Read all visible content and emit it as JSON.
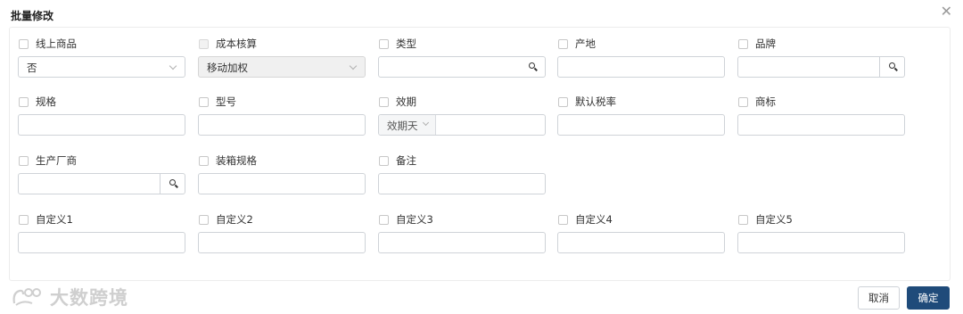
{
  "dialog": {
    "title": "批量修改",
    "close_label": "✕"
  },
  "rows": [
    [
      {
        "key": "online",
        "label": "线上商品",
        "control": "select",
        "value": "否"
      },
      {
        "key": "cost",
        "label": "成本核算",
        "control": "select",
        "value": "移动加权",
        "disabled": true
      },
      {
        "key": "category",
        "label": "类型",
        "control": "search",
        "value": ""
      },
      {
        "key": "origin",
        "label": "产地",
        "control": "input",
        "value": ""
      },
      {
        "key": "brand",
        "label": "品牌",
        "control": "search",
        "value": ""
      }
    ],
    [
      {
        "key": "spec",
        "label": "规格",
        "control": "input",
        "value": ""
      },
      {
        "key": "model",
        "label": "型号",
        "control": "input",
        "value": ""
      },
      {
        "key": "shelf_life",
        "label": "效期",
        "control": "unit-input",
        "unit": "效期天",
        "value": ""
      },
      {
        "key": "tax",
        "label": "默认税率",
        "control": "input",
        "value": ""
      },
      {
        "key": "trademark",
        "label": "商标",
        "control": "input",
        "value": ""
      }
    ],
    [
      {
        "key": "manufacturer",
        "label": "生产厂商",
        "control": "search",
        "value": ""
      },
      {
        "key": "packing",
        "label": "装箱规格",
        "control": "input",
        "value": ""
      },
      {
        "key": "remark",
        "label": "备注",
        "control": "input",
        "value": ""
      }
    ],
    [
      {
        "key": "custom1",
        "label": "自定义1",
        "control": "input",
        "value": ""
      },
      {
        "key": "custom2",
        "label": "自定义2",
        "control": "input",
        "value": ""
      },
      {
        "key": "custom3",
        "label": "自定义3",
        "control": "input",
        "value": ""
      },
      {
        "key": "custom4",
        "label": "自定义4",
        "control": "input",
        "value": ""
      },
      {
        "key": "custom5",
        "label": "自定义5",
        "control": "input",
        "value": ""
      }
    ]
  ],
  "footer": {
    "cancel_label": "取消",
    "ok_label": "确定",
    "ok_color": "#1f4b7a"
  },
  "watermark": {
    "text": "大数跨境"
  }
}
